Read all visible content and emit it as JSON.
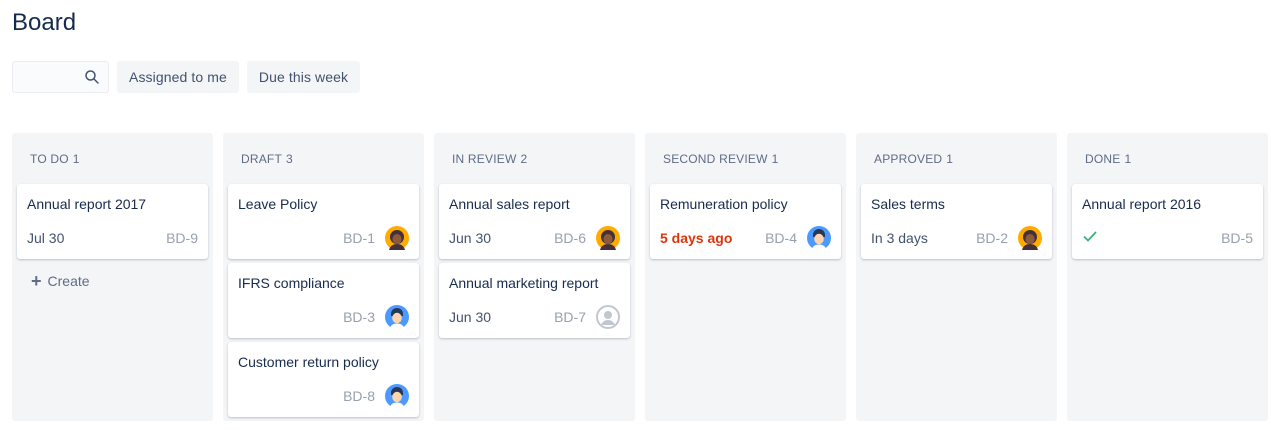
{
  "page": {
    "title": "Board"
  },
  "filters": {
    "search_placeholder": "",
    "assigned_label": "Assigned to me",
    "due_label": "Due this week"
  },
  "colors": {
    "overdue": "#de350b",
    "done_check": "#36b37e",
    "column_bg": "#f4f5f7"
  },
  "columns": [
    {
      "name": "TO DO",
      "count": "1",
      "create_label": "Create",
      "cards": [
        {
          "title": "Annual report 2017",
          "due": "Jul 30",
          "key": "BD-9",
          "avatar": "none"
        }
      ]
    },
    {
      "name": "DRAFT",
      "count": "3",
      "cards": [
        {
          "title": "Leave Policy",
          "due": "",
          "key": "BD-1",
          "avatar": "woman-avatar"
        },
        {
          "title": "IFRS compliance",
          "due": "",
          "key": "BD-3",
          "avatar": "man-avatar"
        },
        {
          "title": "Customer return policy",
          "due": "",
          "key": "BD-8",
          "avatar": "man-avatar"
        }
      ]
    },
    {
      "name": "IN REVIEW",
      "count": "2",
      "cards": [
        {
          "title": "Annual sales report",
          "due": "Jun 30",
          "key": "BD-6",
          "avatar": "woman-avatar"
        },
        {
          "title": "Annual marketing report",
          "due": "Jun 30",
          "key": "BD-7",
          "avatar": "default-avatar"
        }
      ]
    },
    {
      "name": "SECOND REVIEW",
      "count": "1",
      "cards": [
        {
          "title": "Remuneration policy",
          "due": "5 days ago",
          "overdue": true,
          "key": "BD-4",
          "avatar": "man-avatar"
        }
      ]
    },
    {
      "name": "APPROVED",
      "count": "1",
      "cards": [
        {
          "title": "Sales terms",
          "due": "In 3 days",
          "key": "BD-2",
          "avatar": "woman-avatar"
        }
      ]
    },
    {
      "name": "DONE",
      "count": "1",
      "cards": [
        {
          "title": "Annual report 2016",
          "due": "",
          "done": true,
          "key": "BD-5",
          "avatar": "none"
        }
      ]
    }
  ]
}
